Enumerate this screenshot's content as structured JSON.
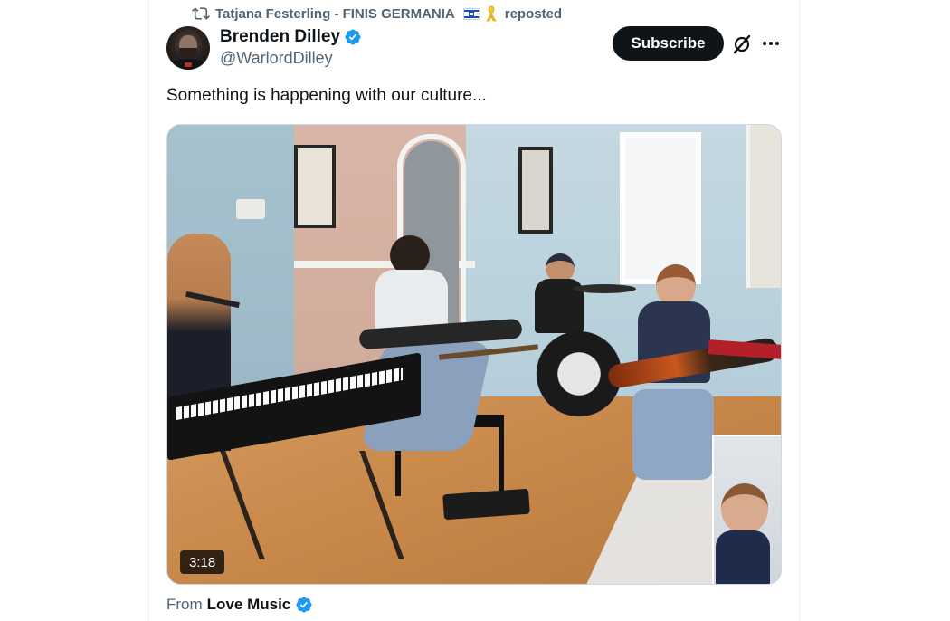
{
  "repost": {
    "user": "Tatjana Festerling - FINIS GERMANIA",
    "label": "reposted",
    "icon": "repost-icon"
  },
  "author": {
    "display_name": "Brenden Dilley",
    "handle": "@WarlordDilley",
    "verified": true
  },
  "actions": {
    "subscribe_label": "Subscribe",
    "grok_icon": "grok-icon",
    "more_icon": "more-icon"
  },
  "tweet": {
    "text": "Something is happening with our culture..."
  },
  "media": {
    "type": "video",
    "duration": "3:18"
  },
  "attribution": {
    "prefix": "From",
    "source": "Love Music",
    "verified": true
  },
  "colors": {
    "text_primary": "#0f1419",
    "text_secondary": "#536471",
    "verified_blue": "#1d9bf0",
    "button_bg": "#0f1419"
  }
}
